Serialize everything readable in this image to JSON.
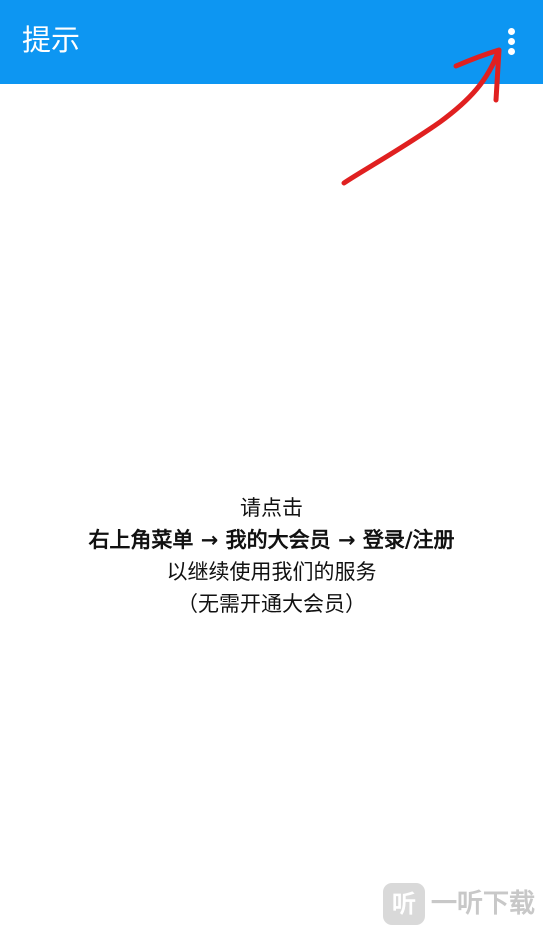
{
  "toolbar": {
    "title": "提示",
    "menu_icon": "more-vert-icon",
    "color": "#0d96f2"
  },
  "annotation": {
    "arrow_color": "#e02020"
  },
  "message": {
    "line1": "请点击",
    "line2": "右上角菜单 → 我的大会员 → 登录/注册",
    "line3": "以继续使用我们的服务",
    "line4": "（无需开通大会员）"
  },
  "watermark": {
    "badge": "听",
    "text": "一听下载"
  }
}
